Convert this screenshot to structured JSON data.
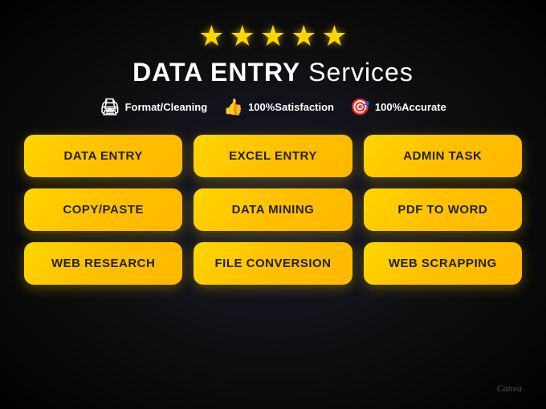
{
  "header": {
    "stars": [
      "★",
      "★",
      "★",
      "★",
      "★"
    ],
    "title_bold": "DATA ENTRY",
    "title_normal": " Services"
  },
  "subtitle_items": [
    {
      "icon": "🖨",
      "text": "Format/Cleaning"
    },
    {
      "icon": "👍",
      "text": "100%Satisfaction"
    },
    {
      "icon": "🎯",
      "text": "100%Accurate"
    }
  ],
  "buttons": [
    "DATA ENTRY",
    "EXCEL ENTRY",
    "ADMIN TASK",
    "COPY/PASTE",
    "DATA MINING",
    "PDF to WORD",
    "WEB RESEARCH",
    "FILE CONVERSION",
    "WEB SCRAPPING"
  ],
  "watermark": "Canva"
}
